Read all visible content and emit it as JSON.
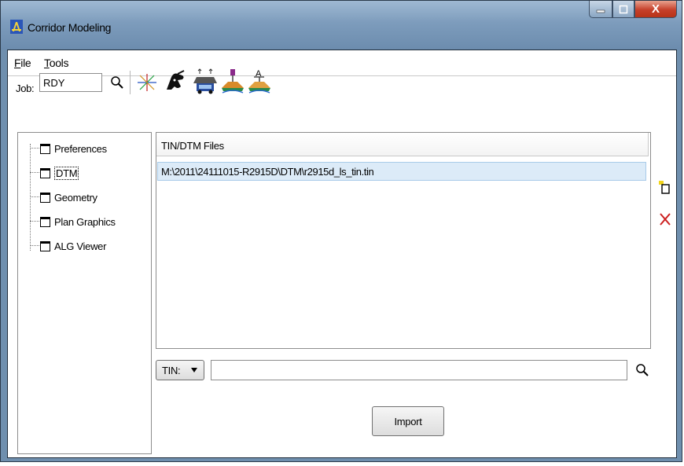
{
  "window": {
    "title": "Corridor Modeling",
    "controls": {
      "minimize": "minimize",
      "maximize": "maximize",
      "close": "X"
    }
  },
  "menu": {
    "file": {
      "accel": "F",
      "rest": "ile"
    },
    "tools": {
      "accel": "T",
      "rest": "ools"
    }
  },
  "toolbar": {
    "job_label": "Job:",
    "job_value": "RDY",
    "icons": [
      "search-icon",
      "axis-icon",
      "hand-pen-icon",
      "car-roadway-icon",
      "template-sign-icon",
      "template-a-icon"
    ]
  },
  "tree": {
    "items": [
      {
        "label": "Preferences",
        "selected": false
      },
      {
        "label": "DTM",
        "selected": true
      },
      {
        "label": "Geometry",
        "selected": false
      },
      {
        "label": "Plan Graphics",
        "selected": false
      },
      {
        "label": "ALG Viewer",
        "selected": false
      }
    ]
  },
  "files": {
    "header": "TIN/DTM Files",
    "rows": [
      "M:\\2011\\24111015-R2915D\\DTM\\r2915d_ls_tin.tin"
    ]
  },
  "side_icons": [
    "new-file-icon",
    "delete-icon"
  ],
  "bottom": {
    "tin_dropdown": "TIN:",
    "tin_value": "",
    "import_label": "Import"
  },
  "colors": {
    "title_gradient_top": "#9fb9d3",
    "close_red": "#c6402a",
    "selection": "#dcebf8",
    "delete_red": "#cc1f1f"
  }
}
